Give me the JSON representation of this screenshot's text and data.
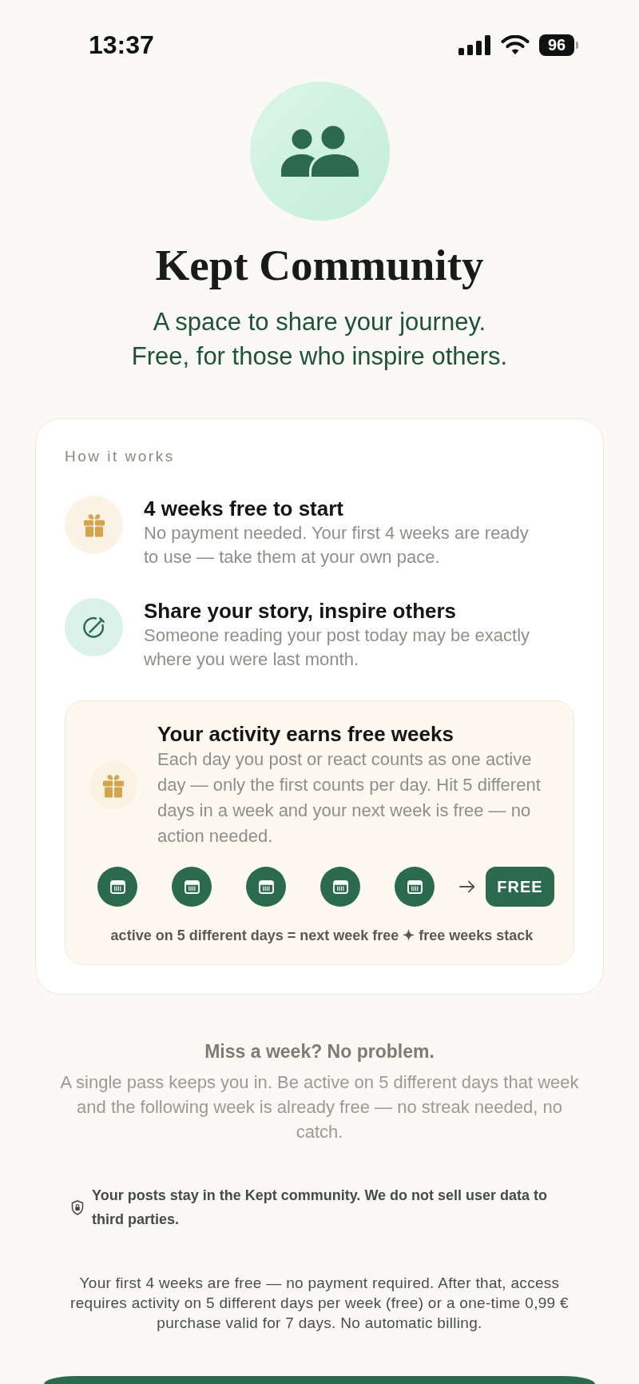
{
  "status_bar": {
    "time": "13:37",
    "battery": "96"
  },
  "header": {
    "title": "Kept Community",
    "subtitle": [
      "A space to share your journey.",
      "Free, for those who inspire others."
    ]
  },
  "how_it_works": {
    "heading": "How it works",
    "items": [
      {
        "kind": "gift",
        "title": "4 weeks free to start",
        "description": "No payment needed. Your first 4 weeks are ready to use — take them at your own pace."
      },
      {
        "kind": "pen",
        "title": "Share your story, inspire others",
        "description": "Someone reading your post today may be exactly where you were last month."
      }
    ],
    "activity": {
      "title": "Your activity earns free weeks",
      "description": "Each day you post or react counts as one active day — only the first counts per day. Hit 5 different days in a week and your next week is free — no action needed.",
      "days": [
        {
          "filled": true
        },
        {
          "filled": true
        },
        {
          "filled": true
        },
        {
          "filled": true
        },
        {
          "filled": true
        }
      ],
      "reward": "FREE",
      "footnote": "active on 5 different days = next week free ✦ free weeks stack"
    }
  },
  "miss_a_week": {
    "title": "Miss a week? No problem.",
    "body": "A single pass keeps you in. Be active on 5 different days that week and the following week is already free — no streak needed, no catch."
  },
  "privacy_note": "Your posts stay in the Kept community. We do not sell user data to third parties.",
  "legal_text": "Your first 4 weeks are free — no payment required. After that, access requires activity on 5 different days per week (free) or a one-time 0,99 € purchase valid for 7 days. No automatic billing."
}
